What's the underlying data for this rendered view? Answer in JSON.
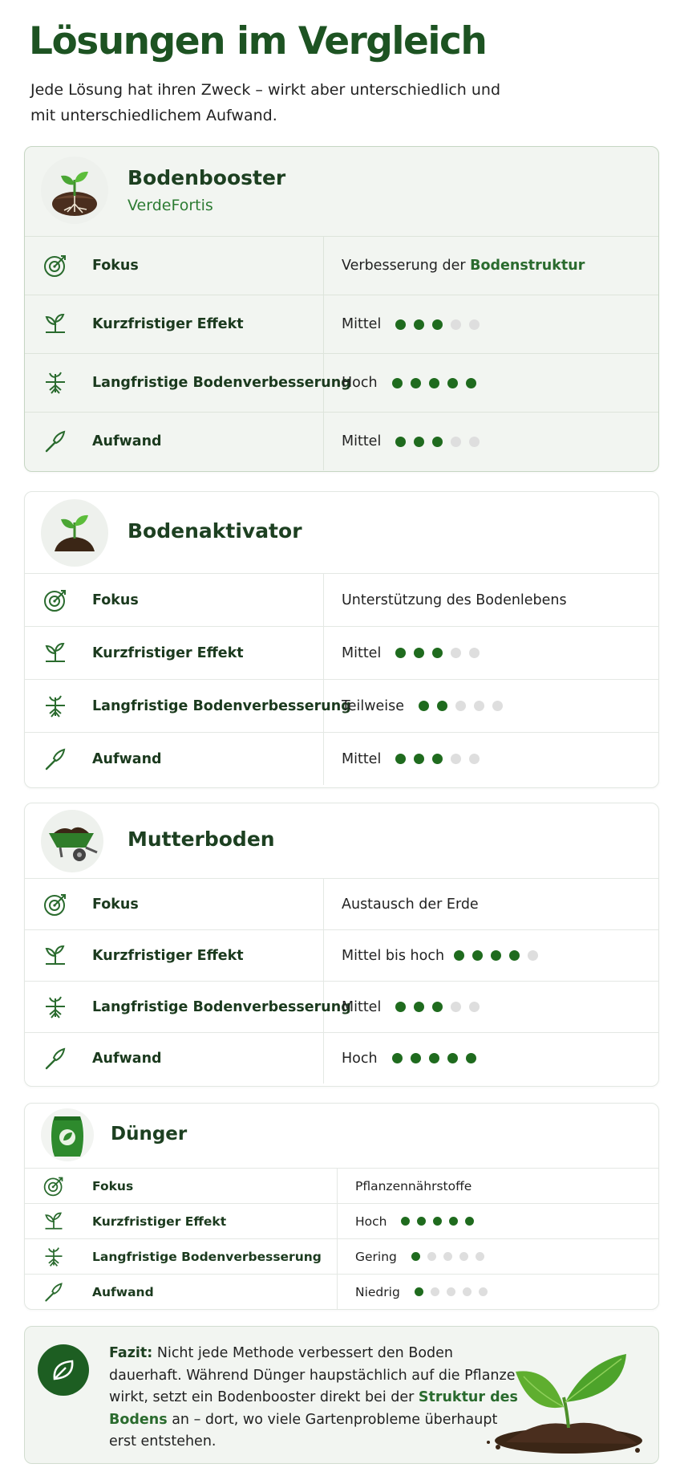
{
  "header": {
    "title": "Lösungen im Vergleich",
    "intro": "Jede Lösung hat ihren Zweck – wirkt aber unterschiedlich und mit unterschiedlichem Aufwand."
  },
  "cards": [
    {
      "name": "Bodenbooster",
      "subtitle": "VerdeFortis",
      "icon": "seedling-roots-icon",
      "rows": [
        {
          "label": "Fokus",
          "icon": "target-icon",
          "value_prefix": "Verbesserung der ",
          "value_highlight": "Bodenstruktur"
        },
        {
          "label": "Kurzfristiger Effekt",
          "icon": "sprout-icon",
          "value": "Mittel",
          "rating": 3,
          "max": 5
        },
        {
          "label": "Langfristige Bodenverbesserung",
          "icon": "roots-icon",
          "value": "Hoch",
          "rating": 5,
          "max": 5
        },
        {
          "label": "Aufwand",
          "icon": "trowel-icon",
          "value": "Mittel",
          "rating": 3,
          "max": 5
        }
      ]
    },
    {
      "name": "Bodenaktivator",
      "icon": "seedling-soil-icon",
      "rows": [
        {
          "label": "Fokus",
          "icon": "target-icon",
          "value": "Unterstützung des Bodenlebens"
        },
        {
          "label": "Kurzfristiger Effekt",
          "icon": "sprout-icon",
          "value": "Mittel",
          "rating": 3,
          "max": 5
        },
        {
          "label": "Langfristige Bodenverbesserung",
          "icon": "roots-icon",
          "value": "Teilweise",
          "rating": 2,
          "max": 5
        },
        {
          "label": "Aufwand",
          "icon": "trowel-icon",
          "value": "Mittel",
          "rating": 3,
          "max": 5
        }
      ]
    },
    {
      "name": "Mutterboden",
      "icon": "wheelbarrow-icon",
      "rows": [
        {
          "label": "Fokus",
          "icon": "target-icon",
          "value": "Austausch der Erde"
        },
        {
          "label": "Kurzfristiger Effekt",
          "icon": "sprout-icon",
          "value": "Mittel bis hoch",
          "rating": 4,
          "max": 5
        },
        {
          "label": "Langfristige Bodenverbesserung",
          "icon": "roots-icon",
          "value": "Mittel",
          "rating": 3,
          "max": 5
        },
        {
          "label": "Aufwand",
          "icon": "trowel-icon",
          "value": "Hoch",
          "rating": 5,
          "max": 5
        }
      ]
    },
    {
      "name": "Dünger",
      "icon": "fertilizer-bag-icon",
      "rows": [
        {
          "label": "Fokus",
          "icon": "target-icon",
          "value": "Pflanzennährstoffe"
        },
        {
          "label": "Kurzfristiger Effekt",
          "icon": "sprout-icon",
          "value": "Hoch",
          "rating": 5,
          "max": 5
        },
        {
          "label": "Langfristige Bodenverbesserung",
          "icon": "roots-icon",
          "value": "Gering",
          "rating": 1,
          "max": 5
        },
        {
          "label": "Aufwand",
          "icon": "trowel-icon",
          "value": "Niedrig",
          "rating": 1,
          "max": 5
        }
      ]
    }
  ],
  "fazit": {
    "lead": "Fazit:",
    "text_1": " Nicht jede Methode verbessert den Boden dauerhaft. Während Dünger haupstächlich auf die Pflanze wirkt, setzt ein Bodenbooster direkt bei der ",
    "highlight": "Struktur des Bodens",
    "text_2": " an – dort, wo viele Gartenprobleme überhaupt erst entstehen.",
    "badge_icon": "leaf-icon",
    "illustration_icon": "plant-in-soil-icon"
  },
  "colors": {
    "primary": "#1d5322",
    "accent": "#2a6b2e",
    "dot_on": "#1f6b1e",
    "dot_off": "#dedede"
  }
}
